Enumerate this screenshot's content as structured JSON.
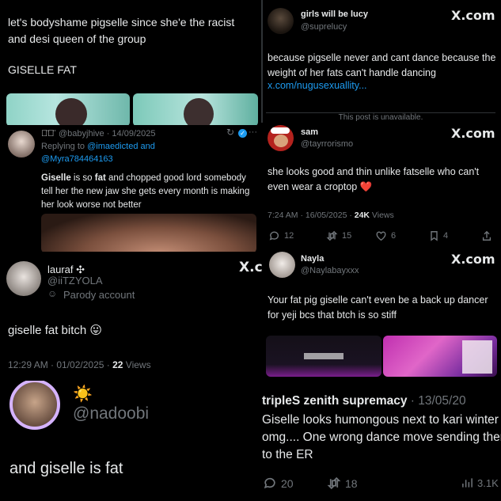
{
  "p1": {
    "text": "let's bodyshame pigselle since she'e the racist and desi queen of the group",
    "text2": "GISELLE FAT"
  },
  "p2": {
    "name": "girls will be lucy",
    "handle": "@suprelucy",
    "x_logo": "X.com",
    "body": "because pigselle never and cant dance because the weight of her fats can't handle dancing",
    "link": "x.com/nugusexuallity..."
  },
  "p3": {
    "name_prefix": "ﾗ̈ｽ̈",
    "handle_date": "@babyjhive · 14/09/2025",
    "reply_prefix": "Replying to",
    "reply_user1": "@imaedicted and",
    "reply_user2": "@Myra784464163",
    "body_word1": "Giselle",
    "body_mid": " is so ",
    "body_word2": "fat",
    "body_rest": " and chopped good lord somebody tell her the new jaw she gets every month is making her look worse not better",
    "dots": "···"
  },
  "p4": {
    "unavailable": "This post is unavailable.",
    "name": "sam",
    "handle": "@tayrrorismo",
    "x_logo": "X.com",
    "body": "she looks good and thin unlike fatselle who can't even wear a croptop",
    "heart": "❤️",
    "time": "7:24 AM · 16/05/2025 · ",
    "views_count": "24K",
    "views_label": " Views",
    "replies": "12",
    "reposts": "15",
    "likes": "6",
    "bookmarks": "4"
  },
  "p5": {
    "name": "lauraf ✣",
    "handle": "@iiTZYOLA",
    "parody": "Parody account",
    "x_logo": "X.c",
    "body": "giselle fat bitch",
    "emoji": "😛",
    "time": "12:29 AM · 01/02/2025 · ",
    "views_count": "22",
    "views_label": " Views"
  },
  "p6": {
    "name": "Nayla",
    "handle": "@Naylabayxxx",
    "x_logo": "X.com",
    "body": "Your fat pig giselle can't even be a back up dancer for yeji bcs that btch is so stiff"
  },
  "p7": {
    "sun": "☀️",
    "handle": "@nadoobi",
    "body": "and giselle is fat"
  },
  "p8": {
    "name": "tripleS zenith supremacy",
    "date": " · 13/05/20",
    "body": "Giselle looks humongous next to kari winter omg.... One wrong dance move sending them to the ER",
    "replies": "20",
    "reposts": "18",
    "views": "3.1K"
  },
  "colors": {
    "background": "#000000",
    "text": "#e7e9ea",
    "muted": "#71767b",
    "link": "#1d9bf0",
    "heart": "#f4212e"
  }
}
